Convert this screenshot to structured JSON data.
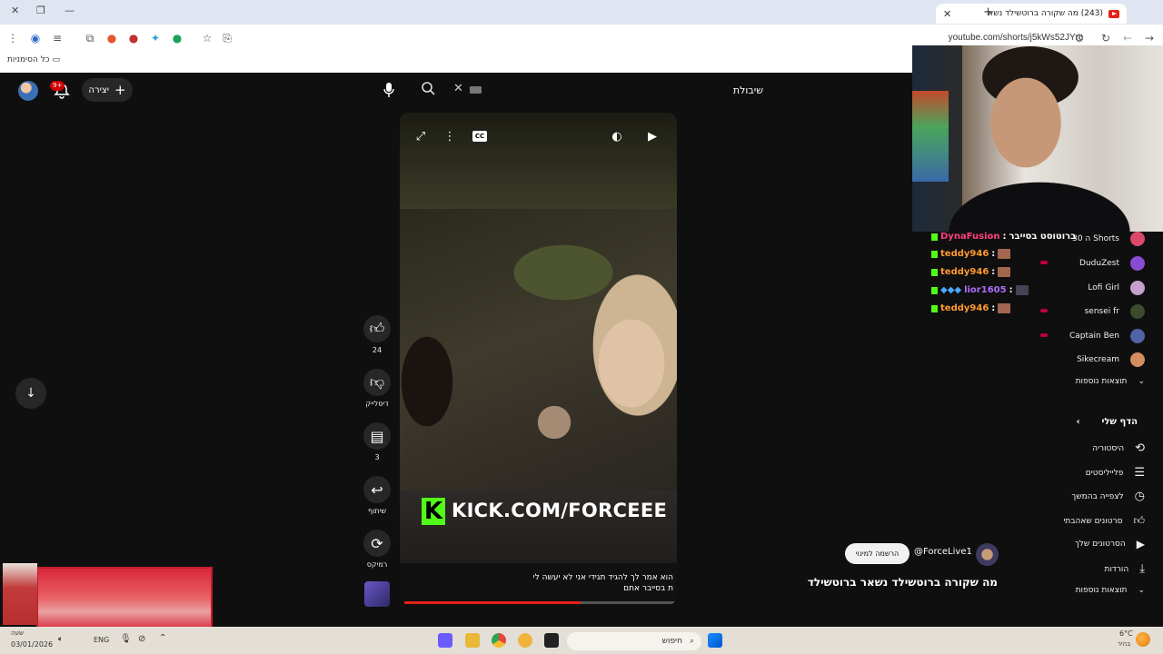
{
  "browser": {
    "tab_title": "(243) מה שקורה ברוטשילד נשא",
    "url": "youtube.com/shorts/j5kWs52JYrc",
    "bookmarks_label": "כל הסימניות"
  },
  "header": {
    "search_value": "שיבולת",
    "create_label": "יצירה",
    "notification_count": "9+"
  },
  "video": {
    "kick_text": "KICK.COM/FORCEEE",
    "caption_line1": "הוא אמר לך להגיד תגידי אני לא יעשה לי",
    "caption_line2": "ת בסייבר אתם",
    "progress": 0.65
  },
  "actions": {
    "like_count": "24",
    "dislike_label": "דיסלייק",
    "comments_count": "3",
    "share_label": "שיתוף",
    "remix_label": "רמיקס"
  },
  "chat": [
    {
      "user": "DynaFusion",
      "color": "#ff4081",
      "message": "ברוטוסט בסייבר"
    },
    {
      "user": "teddy946",
      "color": "#ff9a2e",
      "message": ""
    },
    {
      "user": "teddy946",
      "color": "#ff9a2e",
      "message": ""
    },
    {
      "user": "lior1605",
      "color": "#b06cff",
      "message": ""
    },
    {
      "user": "teddy946",
      "color": "#ff9a2e",
      "message": ""
    }
  ],
  "sidebar": {
    "subscriptions": [
      {
        "label": "ה 30 Shorts",
        "avatar_color": "#d94a6a"
      },
      {
        "label": "DuduZest",
        "avatar_color": "#8a4cd1"
      },
      {
        "label": "Lofi Girl",
        "avatar_color": "#c8a0d0"
      },
      {
        "label": "sensei fr",
        "avatar_color": "#3c4a2e"
      },
      {
        "label": "Captain Ben",
        "avatar_color": "#5062a8"
      },
      {
        "label": "Sikecream",
        "avatar_color": "#d68b60"
      }
    ],
    "more_results_1": "תוצאות נוספות",
    "section_title": "הדף שלי",
    "my_items": [
      {
        "label": "היסטוריה",
        "icon": "history-icon"
      },
      {
        "label": "פלייליסטים",
        "icon": "playlists-icon"
      },
      {
        "label": "לצפייה בהמשך",
        "icon": "watch-later-icon"
      },
      {
        "label": "סרטונים שאהבתי",
        "icon": "liked-videos-icon"
      },
      {
        "label": "הסרטונים שלך",
        "icon": "your-videos-icon"
      },
      {
        "label": "הורדות",
        "icon": "downloads-icon"
      }
    ],
    "more_results_2": "תוצאות נוספות"
  },
  "short_info": {
    "channel": "@ForceLive1",
    "subscribe_label": "הרשמה למינוי",
    "title": "מה שקורה ברוטשילד נשאר ברוטשילד"
  },
  "taskbar": {
    "search_label": "חיפוש",
    "time": "שעה",
    "date": "03/01/2026",
    "language": "ENG",
    "weather_temp": "6°C",
    "weather_desc": "בהיר"
  }
}
